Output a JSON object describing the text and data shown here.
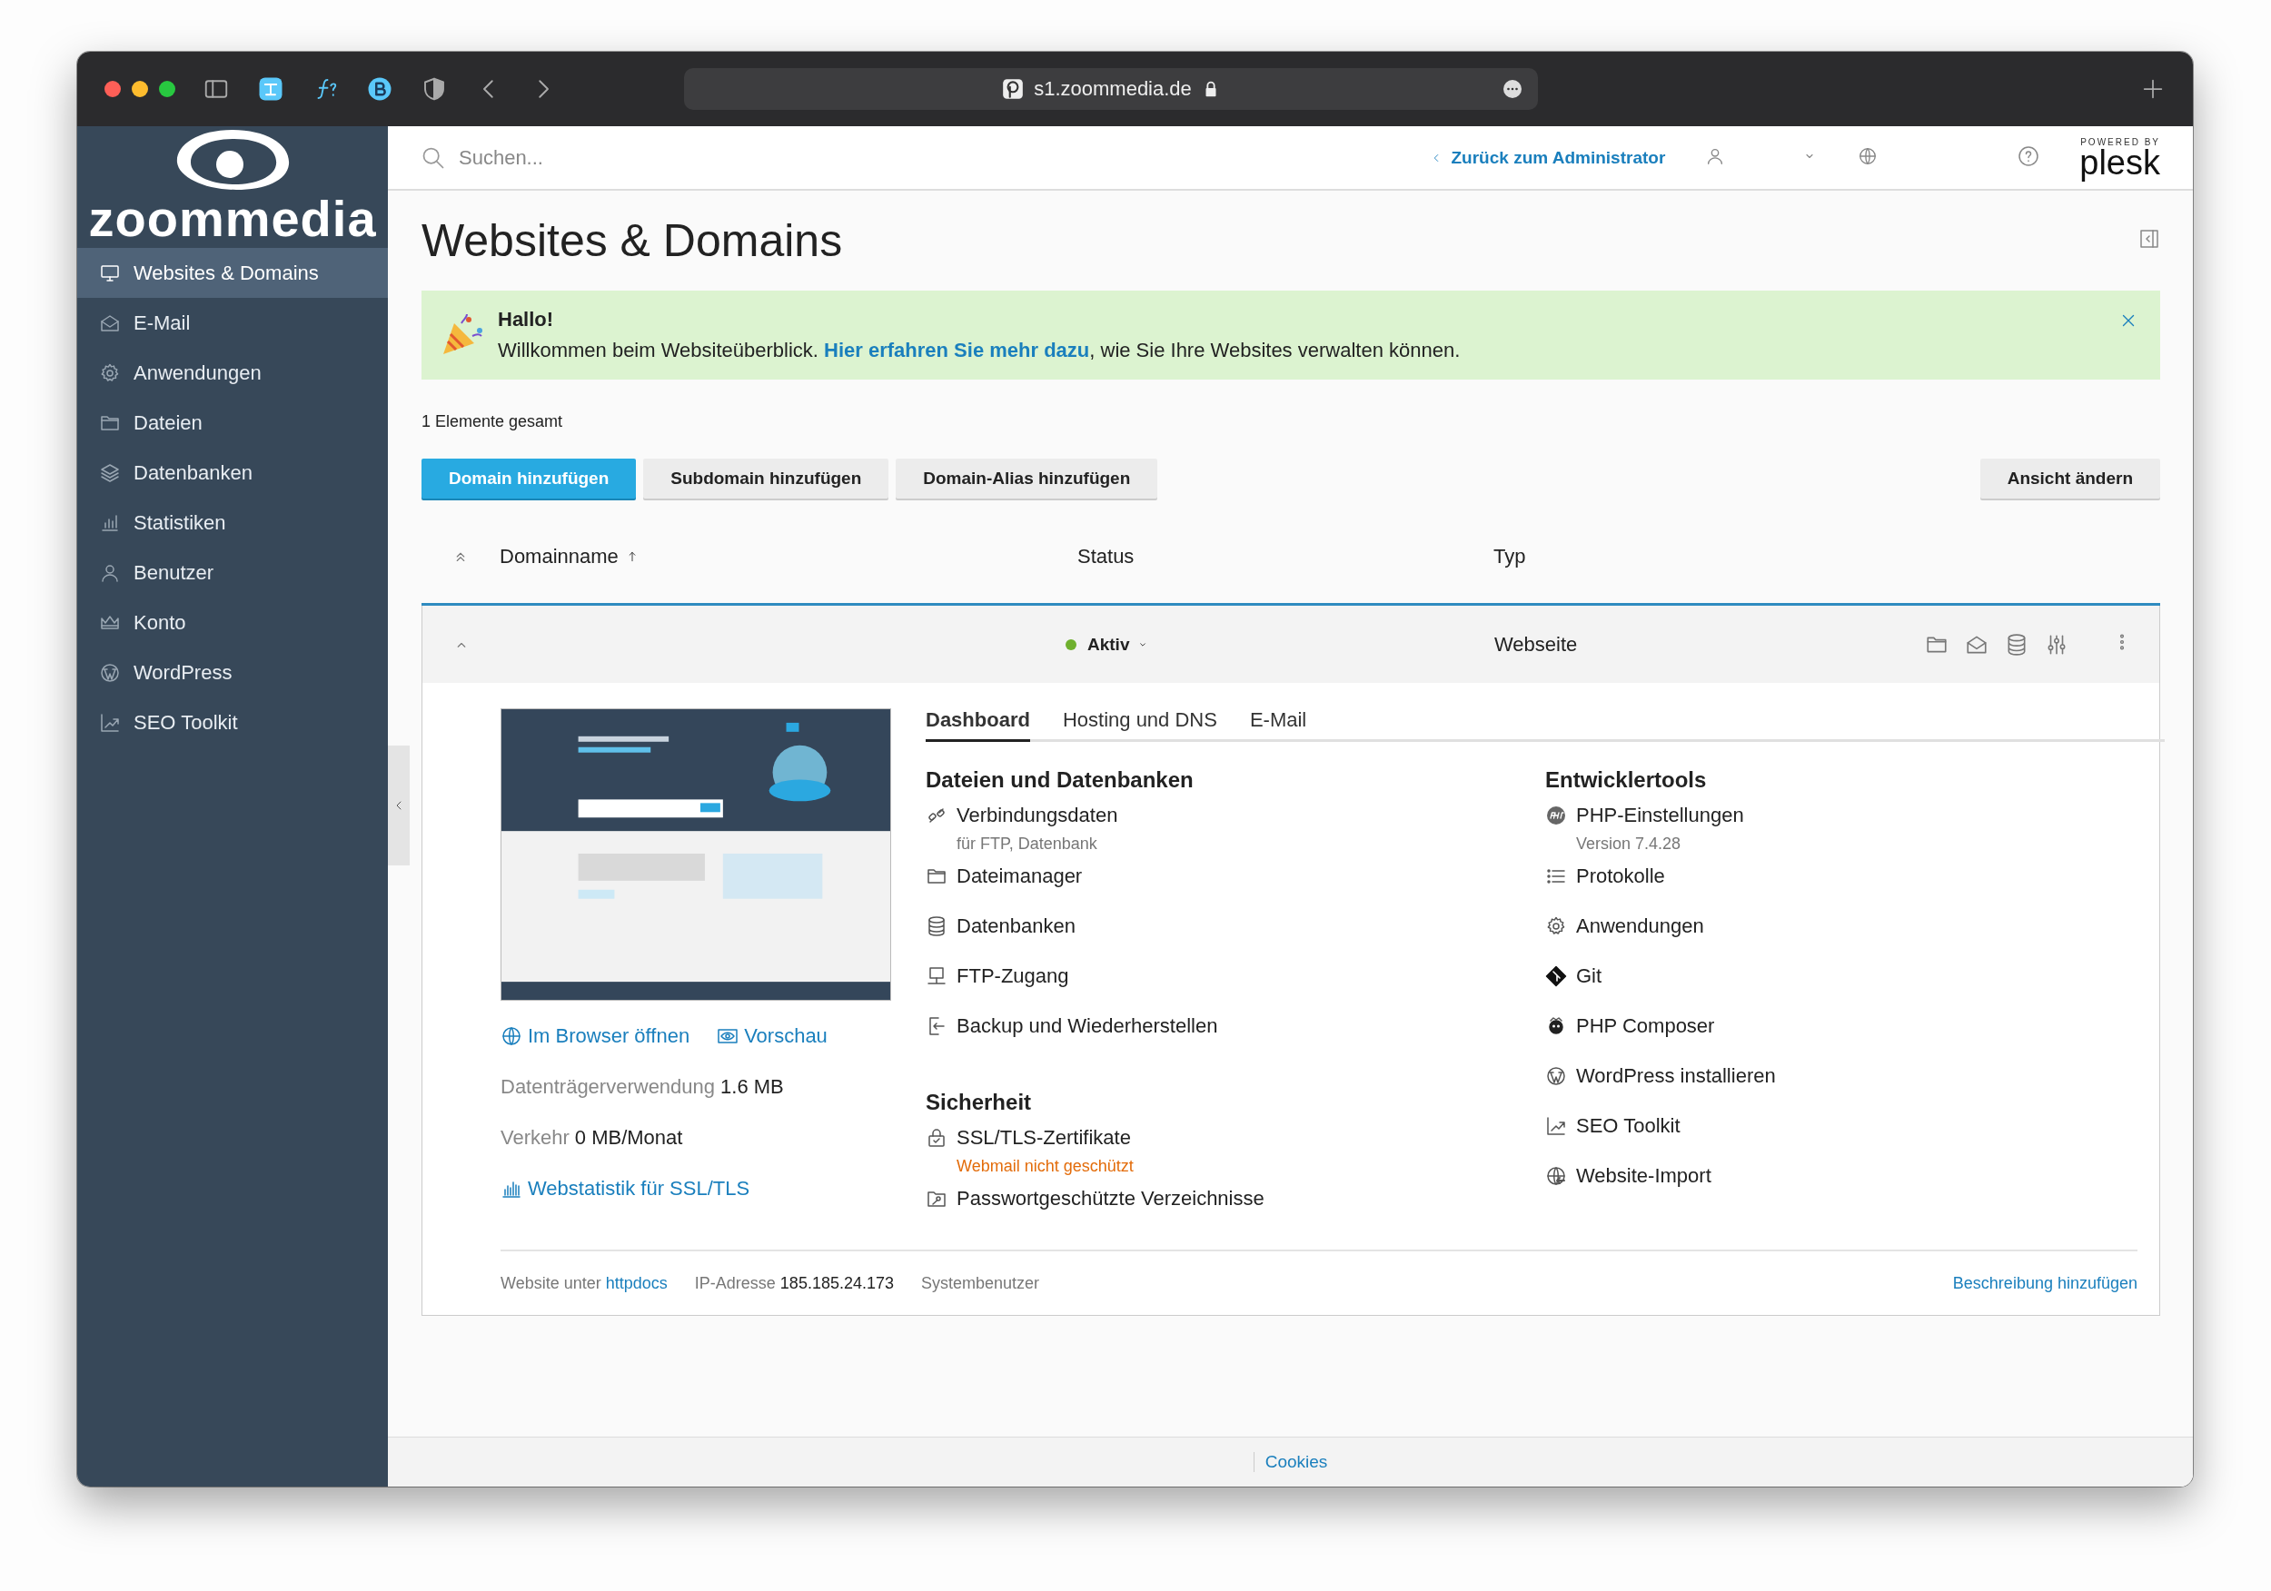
{
  "browser": {
    "url": "s1.zoommedia.de"
  },
  "sidebar": {
    "brand": "zoommedia",
    "items": [
      {
        "label": "Websites & Domains",
        "selected": true
      },
      {
        "label": "E-Mail",
        "selected": false
      },
      {
        "label": "Anwendungen",
        "selected": false
      },
      {
        "label": "Dateien",
        "selected": false
      },
      {
        "label": "Datenbanken",
        "selected": false
      },
      {
        "label": "Statistiken",
        "selected": false
      },
      {
        "label": "Benutzer",
        "selected": false
      },
      {
        "label": "Konto",
        "selected": false
      },
      {
        "label": "WordPress",
        "selected": false
      },
      {
        "label": "SEO Toolkit",
        "selected": false
      }
    ]
  },
  "header": {
    "search": {
      "placeholder": "Suchen..."
    },
    "back_link": "Zurück zum Administrator",
    "powered_by": "POWERED BY",
    "brand": "plesk"
  },
  "page": {
    "title": "Websites & Domains"
  },
  "banner": {
    "title": "Hallo!",
    "text_before": "Willkommen beim Websiteüberblick. ",
    "link": "Hier erfahren Sie mehr dazu",
    "text_after": ", wie Sie Ihre Websites verwalten können."
  },
  "summary": "1 Elemente gesamt",
  "toolbar": {
    "buttons": [
      {
        "label": "Domain hinzufügen",
        "kind": "primary"
      },
      {
        "label": "Subdomain hinzufügen",
        "kind": "secondary"
      },
      {
        "label": "Domain-Alias hinzufügen",
        "kind": "secondary"
      }
    ],
    "view_button": "Ansicht ändern"
  },
  "table": {
    "columns": [
      "Domainname",
      "Status",
      "Typ"
    ],
    "rows": [
      {
        "status": "Aktiv",
        "type": "Webseite",
        "expanded": true,
        "detail": {
          "open_link": "Im Browser öffnen",
          "preview_link": "Vorschau",
          "disk_usage": {
            "label": "Datenträgerverwendung",
            "value": "1.6 MB"
          },
          "traffic": {
            "label": "Verkehr",
            "value": "0 MB/Monat"
          },
          "stats_link": "Webstatistik für SSL/TLS",
          "tabs": [
            {
              "label": "Dashboard",
              "selected": true
            },
            {
              "label": "Hosting und DNS",
              "selected": false
            },
            {
              "label": "E-Mail",
              "selected": false
            }
          ],
          "columns": [
            [
              {
                "title": "Dateien und Datenbanken",
                "items": [
                  {
                    "label": "Verbindungsdaten",
                    "sub": {
                      "text": "für FTP, Datenbank",
                      "kind": "note"
                    }
                  },
                  {
                    "label": "Dateimanager"
                  },
                  {
                    "label": "Datenbanken"
                  },
                  {
                    "label": "FTP-Zugang"
                  },
                  {
                    "label": "Backup und Wiederherstellen"
                  }
                ]
              },
              {
                "title": "Sicherheit",
                "items": [
                  {
                    "label": "SSL/TLS-Zertifikate",
                    "sub": {
                      "text": "Webmail nicht geschützt",
                      "kind": "warning"
                    }
                  },
                  {
                    "label": "Passwortgeschützte Verzeichnisse"
                  }
                ]
              }
            ],
            [
              {
                "title": "Entwicklertools",
                "items": [
                  {
                    "label": "PHP-Einstellungen",
                    "sub": {
                      "text": "Version 7.4.28",
                      "kind": "note"
                    }
                  },
                  {
                    "label": "Protokolle"
                  },
                  {
                    "label": "Anwendungen"
                  },
                  {
                    "label": "Git"
                  },
                  {
                    "label": "PHP Composer"
                  },
                  {
                    "label": "WordPress installieren"
                  },
                  {
                    "label": "SEO Toolkit"
                  },
                  {
                    "label": "Website-Import"
                  }
                ]
              }
            ]
          ],
          "info": {
            "docroot_label": "Website unter",
            "docroot": "httpdocs",
            "ip_label": "IP-Adresse",
            "ip": "185.185.24.173",
            "user_label": "Systembenutzer"
          },
          "add_description": "Beschreibung hinzufügen"
        }
      }
    ]
  },
  "footer": {
    "link": "Cookies"
  }
}
